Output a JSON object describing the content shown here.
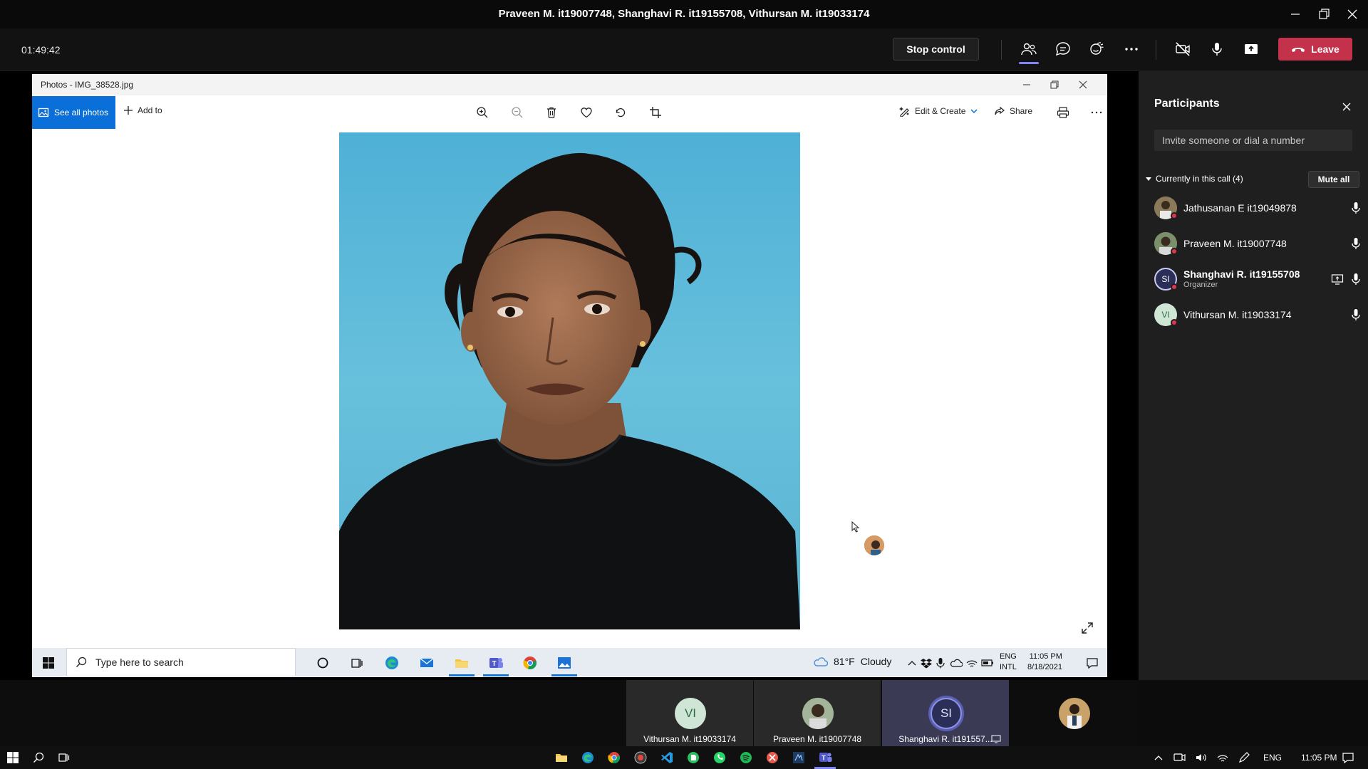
{
  "window": {
    "title": "Praveen M. it19007748, Shanghavi R. it19155708, Vithursan M. it19033174"
  },
  "toolbar": {
    "timer": "01:49:42",
    "stop_control_label": "Stop control",
    "leave_label": "Leave",
    "icons": [
      "people-icon",
      "chat-icon",
      "reactions-icon",
      "more-icon",
      "camera-off-icon",
      "microphone-icon",
      "share-tray-icon",
      "phone-hangup-icon"
    ]
  },
  "photos_app": {
    "title": "Photos - IMG_38528.jpg",
    "see_all_label": "See all photos",
    "add_to_label": "Add to",
    "edit_create_label": "Edit & Create",
    "share_label": "Share",
    "commands": [
      "zoom-in-icon",
      "zoom-out-icon",
      "delete-icon",
      "favorite-icon",
      "rotate-icon",
      "crop-icon"
    ]
  },
  "inner_taskbar": {
    "search_placeholder": "Type here to search",
    "weather": {
      "temp": "81°F",
      "condition": "Cloudy"
    },
    "lang_line1": "ENG",
    "lang_line2": "INTL",
    "time": "11:05 PM",
    "date": "8/18/2021"
  },
  "participants_panel": {
    "title": "Participants",
    "invite_placeholder": "Invite someone or dial a number",
    "section_label": "Currently in this call (4)",
    "mute_all_label": "Mute all",
    "people": [
      {
        "name": "Jathusanan E it19049878",
        "initials": "",
        "role": "",
        "avatar_color": "#7a6a4e"
      },
      {
        "name": "Praveen M. it19007748",
        "initials": "",
        "role": "",
        "avatar_color": "#5b6e4e"
      },
      {
        "name": "Shanghavi R. it19155708",
        "initials": "SI",
        "role": "Organizer",
        "avatar_color": "#2b2f57"
      },
      {
        "name": "Vithursan M. it19033174",
        "initials": "VI",
        "role": "",
        "avatar_color": "#cfe6d6"
      }
    ]
  },
  "video_strip": {
    "tiles": [
      {
        "name": "Vithursan M. it19033174",
        "initials": "VI"
      },
      {
        "name": "Praveen M. it19007748",
        "initials": ""
      },
      {
        "name": "Shanghavi R. it191557...",
        "initials": "SI"
      }
    ]
  },
  "host_taskbar": {
    "lang": "ENG",
    "time": "11:05 PM"
  },
  "colors": {
    "teams_accent": "#6264a7",
    "leave_red": "#c4314b",
    "photos_blue": "#0a6fd8",
    "status_red": "#e3354b"
  }
}
